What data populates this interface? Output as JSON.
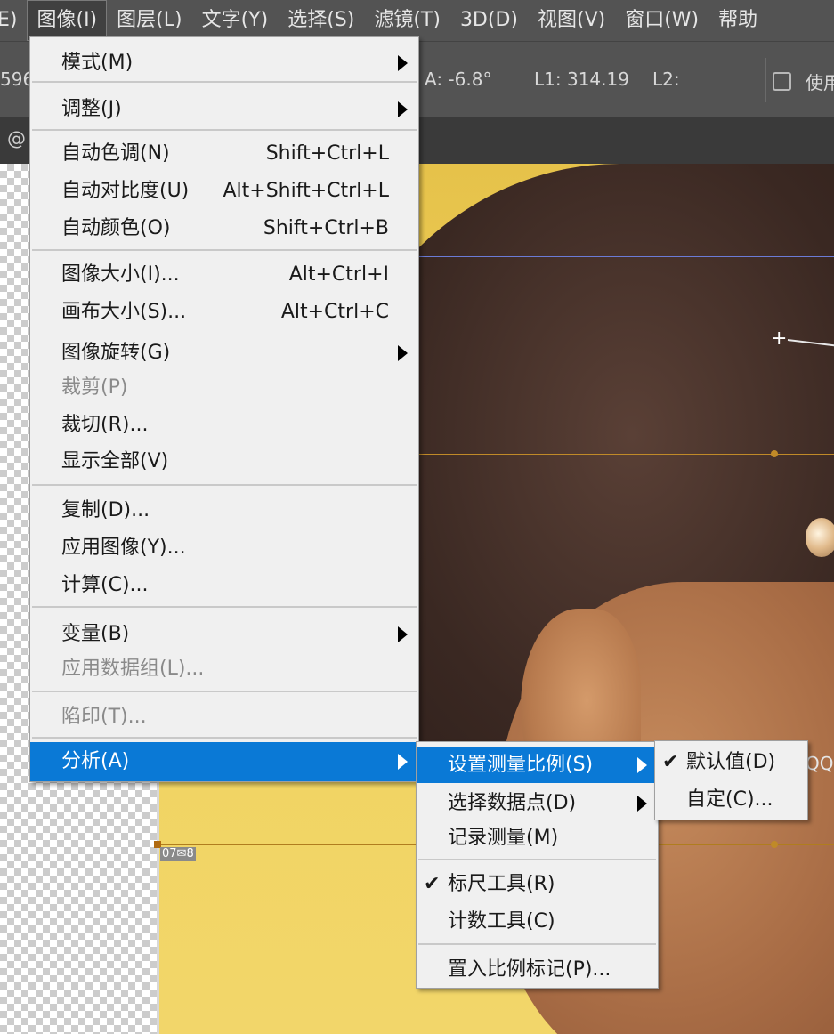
{
  "menubar": {
    "items": [
      {
        "label": "E)"
      },
      {
        "label": "图像(I)"
      },
      {
        "label": "图层(L)"
      },
      {
        "label": "文字(Y)"
      },
      {
        "label": "选择(S)"
      },
      {
        "label": "滤镜(T)"
      },
      {
        "label": "3D(D)"
      },
      {
        "label": "视图(V)"
      },
      {
        "label": "窗口(W)"
      },
      {
        "label": "帮助"
      }
    ],
    "active_item": "图像(I)"
  },
  "options_bar": {
    "partial_value": "596",
    "angle": "A:  -6.8°",
    "l1": "L1:  314.19",
    "l2": "L2:",
    "checkbox_label": "使用"
  },
  "tab_bar": {
    "partial_text": "@"
  },
  "canvas": {
    "measure_label": "07",
    "measure_label_2": "8",
    "watermark": "QQ"
  },
  "image_menu": {
    "items": [
      {
        "label": "模式(M)",
        "submenu": true
      },
      {
        "label": "调整(J)",
        "submenu": true
      },
      {
        "label": "自动色调(N)",
        "shortcut": "Shift+Ctrl+L"
      },
      {
        "label": "自动对比度(U)",
        "shortcut": "Alt+Shift+Ctrl+L"
      },
      {
        "label": "自动颜色(O)",
        "shortcut": "Shift+Ctrl+B"
      },
      {
        "label": "图像大小(I)...",
        "shortcut": "Alt+Ctrl+I"
      },
      {
        "label": "画布大小(S)...",
        "shortcut": "Alt+Ctrl+C"
      },
      {
        "label": "图像旋转(G)",
        "submenu": true
      },
      {
        "label": "裁剪(P)",
        "disabled": true
      },
      {
        "label": "裁切(R)..."
      },
      {
        "label": "显示全部(V)"
      },
      {
        "label": "复制(D)..."
      },
      {
        "label": "应用图像(Y)..."
      },
      {
        "label": "计算(C)..."
      },
      {
        "label": "变量(B)",
        "submenu": true
      },
      {
        "label": "应用数据组(L)...",
        "disabled": true
      },
      {
        "label": "陷印(T)...",
        "disabled": true
      },
      {
        "label": "分析(A)",
        "submenu": true,
        "highlighted": true
      }
    ]
  },
  "analysis_menu": {
    "items": [
      {
        "label": "设置测量比例(S)",
        "submenu": true,
        "highlighted": true
      },
      {
        "label": "选择数据点(D)",
        "submenu": true
      },
      {
        "label": "记录测量(M)"
      },
      {
        "label": "标尺工具(R)",
        "checked": true
      },
      {
        "label": "计数工具(C)"
      },
      {
        "label": "置入比例标记(P)..."
      }
    ]
  },
  "scale_menu": {
    "items": [
      {
        "label": "默认值(D)",
        "checked": true
      },
      {
        "label": "自定(C)..."
      }
    ]
  },
  "colors": {
    "highlight": "#0a79d6",
    "menu_bg": "#f0f0f0",
    "menubar_bg": "#535353"
  }
}
